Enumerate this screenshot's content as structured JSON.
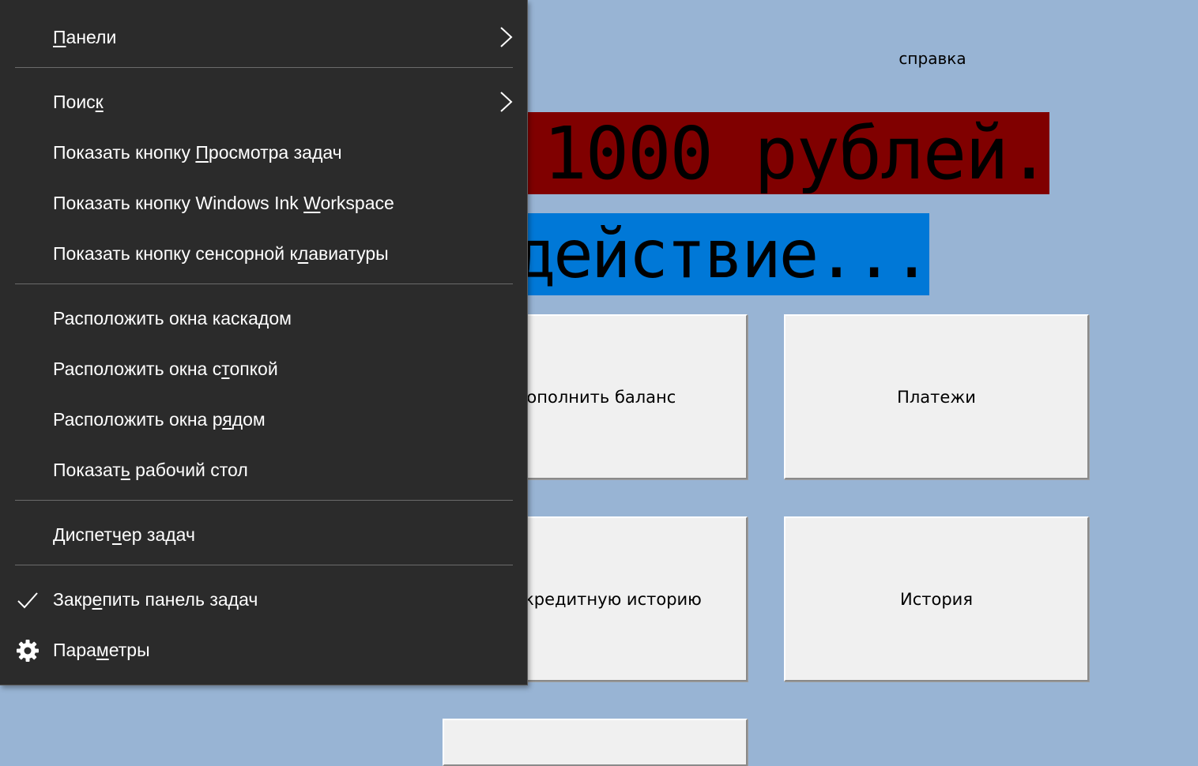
{
  "app": {
    "help_label": "справка",
    "balance_text": "ету: 1000 рублей.",
    "action_text": "е действие...",
    "buttons": {
      "topup": "Пополнить баланс",
      "payments": "Платежи",
      "credit": "ить кредитную историю",
      "history": "История"
    },
    "colors": {
      "background": "#98b4d4",
      "balance_banner": "#800000",
      "action_banner": "#0078d7"
    }
  },
  "context_menu": {
    "items": [
      {
        "pre": "",
        "key": "П",
        "post": "анели",
        "submenu": true
      },
      {
        "pre": "Поис",
        "key": "к",
        "post": "",
        "submenu": true
      },
      {
        "pre": "Показать кнопку ",
        "key": "П",
        "post": "росмотра задач"
      },
      {
        "pre": "Показать кнопку Windows Ink ",
        "key": "W",
        "post": "orkspace"
      },
      {
        "pre": "Показать кнопку сенсорной к",
        "key": "л",
        "post": "авиатуры"
      },
      {
        "pre": "Расположить окна каска",
        "key": "д",
        "post": "ом"
      },
      {
        "pre": "Расположить окна с",
        "key": "т",
        "post": "опкой"
      },
      {
        "pre": "Расположить окна р",
        "key": "я",
        "post": "дом"
      },
      {
        "pre": "Показат",
        "key": "ь",
        "post": " рабочий стол"
      },
      {
        "pre": "Диспет",
        "key": "ч",
        "post": "ер задач"
      },
      {
        "pre": "Закр",
        "key": "е",
        "post": "пить панель задач",
        "checked": true,
        "icon": "check-icon"
      },
      {
        "pre": "Пара",
        "key": "м",
        "post": "етры",
        "icon": "gear-icon"
      }
    ],
    "colors": {
      "background": "#2b2b2b",
      "text": "#ffffff",
      "separator": "#6b6b6b"
    }
  }
}
